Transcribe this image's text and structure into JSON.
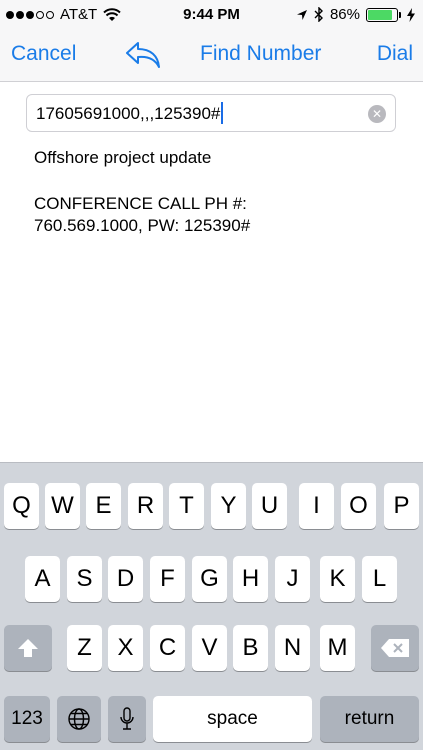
{
  "status_bar": {
    "carrier": "AT&T",
    "time": "9:44 PM",
    "battery": "86%",
    "battery_level": 0.86,
    "signal_bars_filled": 3,
    "signal_bars_total": 5
  },
  "nav": {
    "cancel": "Cancel",
    "find_number": "Find Number",
    "dial": "Dial"
  },
  "input": {
    "value": "17605691000,,,125390#"
  },
  "content": {
    "subject": "Offshore project update",
    "notes_line1": "CONFERENCE CALL PH #:",
    "notes_line2": "760.569.1000, PW: 125390#"
  },
  "keyboard": {
    "row1": [
      "Q",
      "W",
      "E",
      "R",
      "T",
      "Y",
      "U",
      "I",
      "O",
      "P"
    ],
    "row2": [
      "A",
      "S",
      "D",
      "F",
      "G",
      "H",
      "J",
      "K",
      "L"
    ],
    "row3": [
      "Z",
      "X",
      "C",
      "V",
      "B",
      "N",
      "M"
    ],
    "numbers_key": "123",
    "space_key": "space",
    "return_key": "return"
  },
  "colors": {
    "accent": "#1a7ce8",
    "keyboard_bg": "#d1d5db",
    "battery_fill": "#4cd964"
  }
}
